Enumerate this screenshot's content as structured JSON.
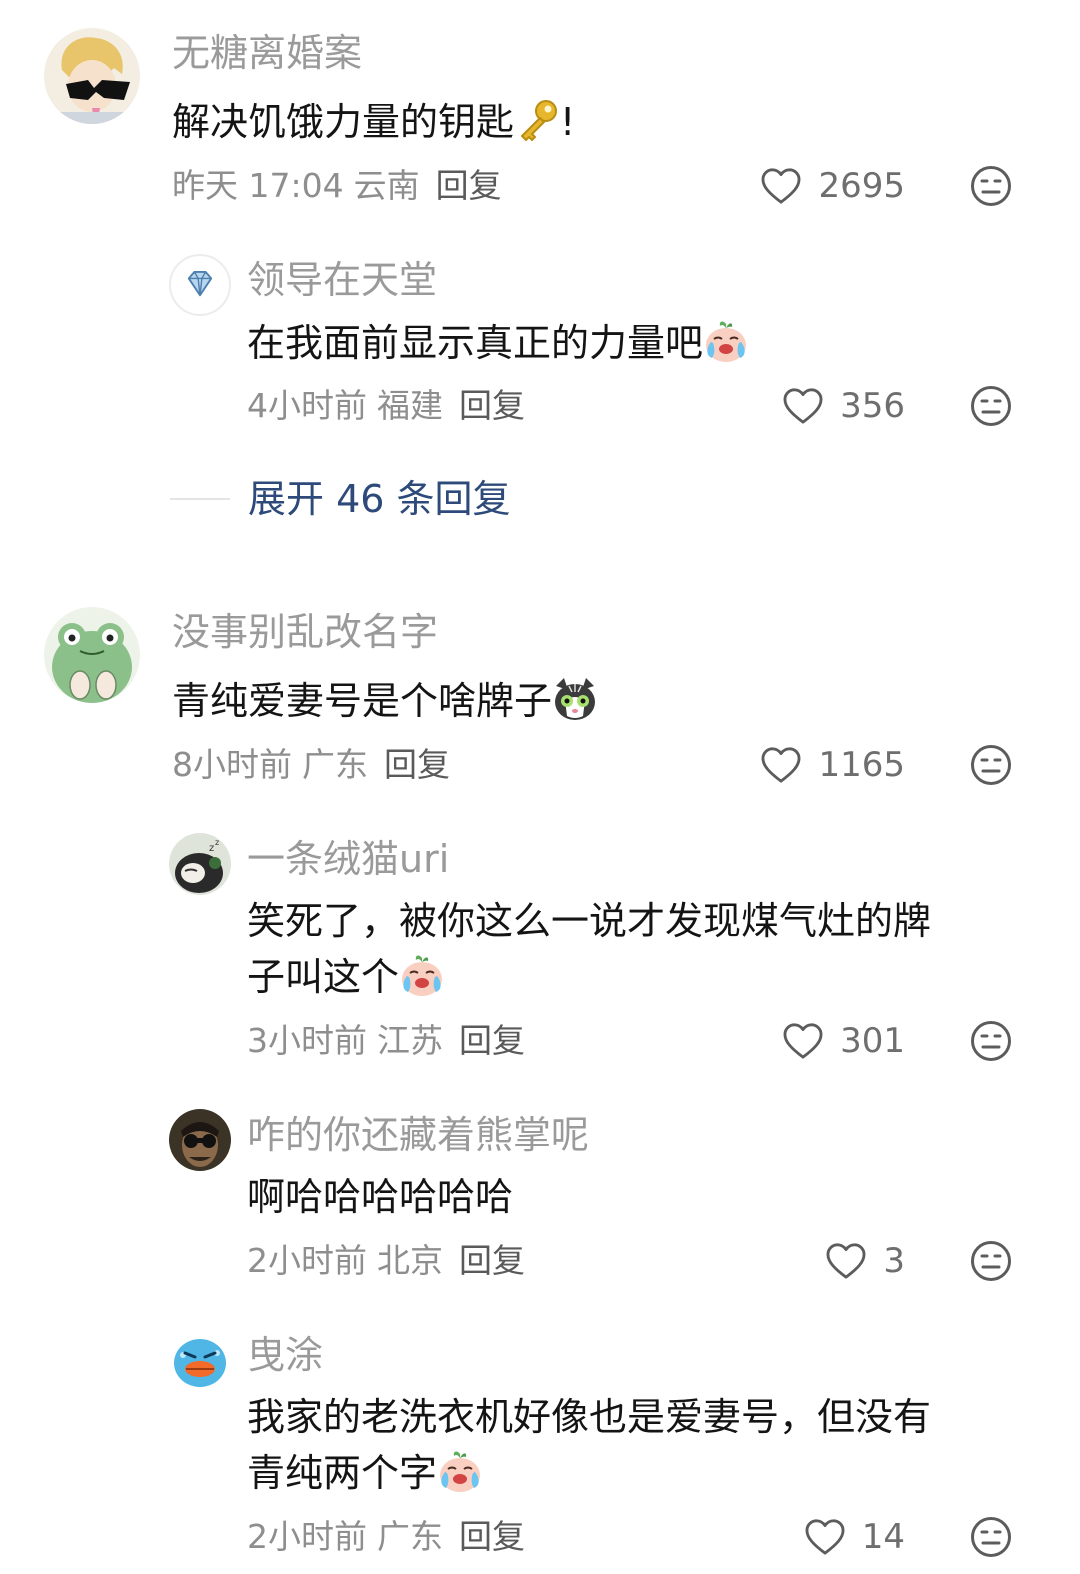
{
  "comments": [
    {
      "username": "无糖离婚案",
      "text": "解决饥饿力量的钥匙",
      "text_suffix": "!",
      "emoji": "key-emoji",
      "time": "昨天 17:04",
      "location": "云南",
      "reply_label": "回复",
      "likes": "2695",
      "avatar": "anime-boy-sunglasses-avatar",
      "replies": [
        {
          "username": "领导在天堂",
          "text": "在我面前显示真正的力量吧",
          "emoji": "crying-laughing-emoji",
          "time": "4小时前",
          "location": "福建",
          "reply_label": "回复",
          "likes": "356",
          "avatar": "diamond-avatar"
        }
      ],
      "expand_label": "展开 46 条回复"
    },
    {
      "username": "没事别乱改名字",
      "text": "青纯爱妻号是个啥牌子",
      "emoji": "shocked-cat-emoji",
      "time": "8小时前",
      "location": "广东",
      "reply_label": "回复",
      "likes": "1165",
      "avatar": "frog-avatar",
      "replies": [
        {
          "username": "一条绒猫uri",
          "text_line1": "笑死了，被你这么一说才发现煤气灶的牌",
          "text_line2": "子叫这个",
          "emoji": "crying-laughing-emoji",
          "time": "3小时前",
          "location": "江苏",
          "reply_label": "回复",
          "likes": "301",
          "avatar": "sleeping-cat-avatar"
        },
        {
          "username": "咋的你还藏着熊掌呢",
          "text": "啊哈哈哈哈哈哈",
          "time": "2小时前",
          "location": "北京",
          "reply_label": "回复",
          "likes": "3",
          "avatar": "man-binoculars-avatar"
        },
        {
          "username": "曳涂",
          "text_line1": "我家的老洗衣机好像也是爱妻号，但没有",
          "text_line2": "青纯两个字",
          "emoji": "crying-laughing-emoji",
          "time": "2小时前",
          "location": "广东",
          "reply_label": "回复",
          "likes": "14",
          "avatar": "blue-duck-avatar"
        }
      ]
    }
  ],
  "colors": {
    "username": "#9a9a9a",
    "text": "#141414",
    "meta": "#8e8e8e",
    "expand": "#2d4a7a",
    "background": "#ffffff"
  }
}
